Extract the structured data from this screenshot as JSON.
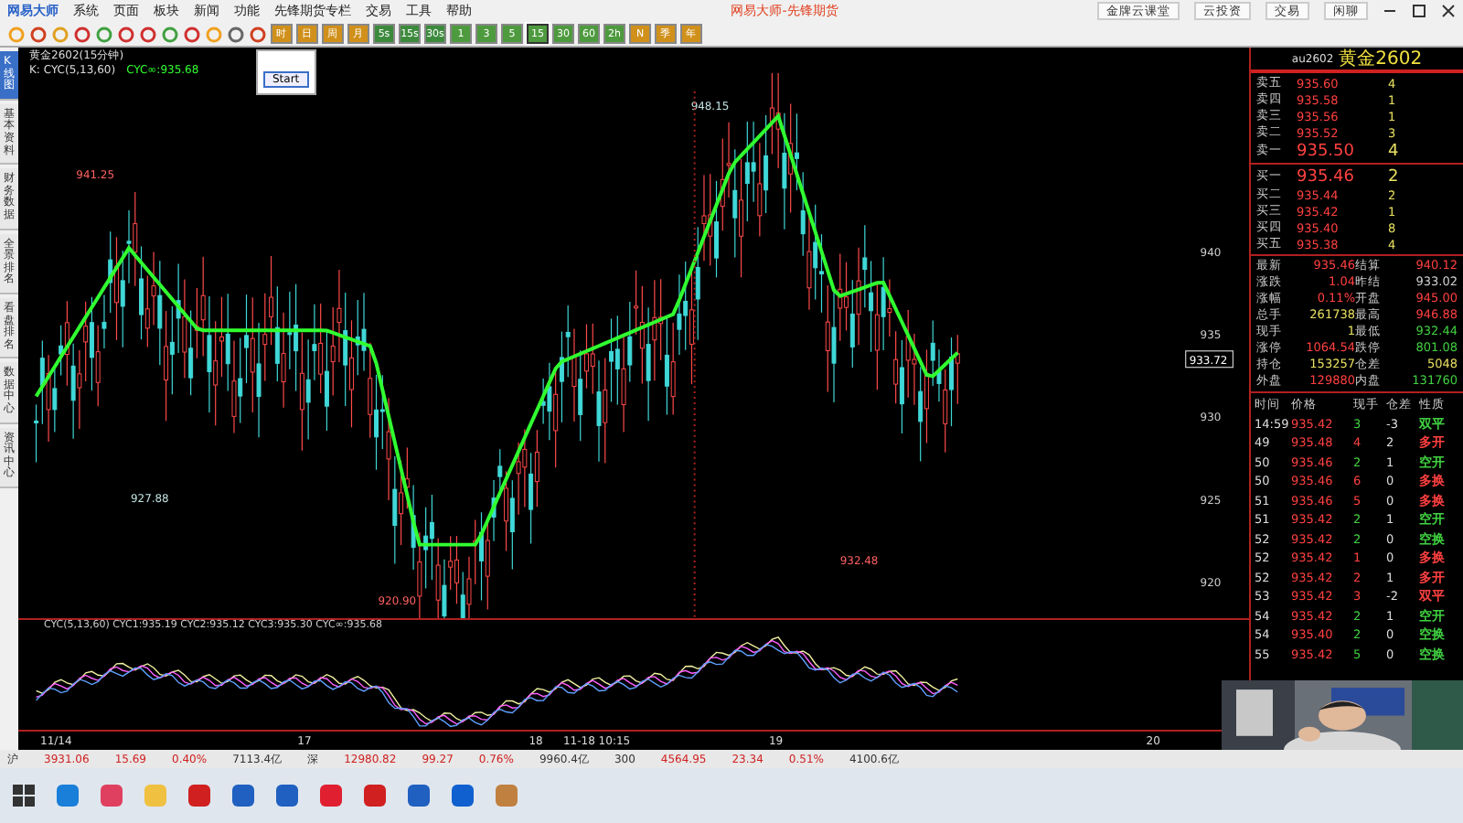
{
  "window": {
    "title": "网易大师-先锋期货",
    "logo": "网易大师"
  },
  "menu": [
    "系统",
    "页面",
    "板块",
    "新闻",
    "功能",
    "先锋期货专栏",
    "交易",
    "工具",
    "帮助"
  ],
  "top_buttons": [
    "金牌云课堂",
    "云投资",
    "交易",
    "闲聊"
  ],
  "periods": [
    {
      "label": "时",
      "selected": false
    },
    {
      "label": "日",
      "selected": false
    },
    {
      "label": "周",
      "selected": false
    },
    {
      "label": "月",
      "selected": false
    },
    {
      "label": "5s",
      "selected": false
    },
    {
      "label": "15s",
      "selected": false
    },
    {
      "label": "30s",
      "selected": false
    },
    {
      "label": "1",
      "selected": false
    },
    {
      "label": "3",
      "selected": false
    },
    {
      "label": "5",
      "selected": false
    },
    {
      "label": "15",
      "selected": true
    },
    {
      "label": "30",
      "selected": false
    },
    {
      "label": "60",
      "selected": false
    },
    {
      "label": "2h",
      "selected": false
    },
    {
      "label": "N",
      "selected": false
    },
    {
      "label": "季",
      "selected": false
    },
    {
      "label": "年",
      "selected": false
    }
  ],
  "side_tabs": [
    {
      "label": "K线图",
      "selected": true
    },
    {
      "label": "基本资料",
      "selected": false
    },
    {
      "label": "财务数据",
      "selected": false
    },
    {
      "label": "全景排名",
      "selected": false
    },
    {
      "label": "看盘排名",
      "selected": false
    },
    {
      "label": "数据中心",
      "selected": false
    },
    {
      "label": "资讯中心",
      "selected": false
    }
  ],
  "popup": {
    "button": "Start"
  },
  "chart": {
    "title": "黄金2602(15分钟)",
    "legend": "K: CYC(5,13,60)",
    "legend_value": "CYC∞:935.68",
    "price_labels": [
      "941.25",
      "927.88",
      "920.90",
      "948.15",
      "932.48"
    ],
    "y_ticks": [
      "940",
      "935",
      "930",
      "925",
      "920"
    ],
    "current_price": "933.72",
    "indicator_legend": "CYC(5,13,60) CYC1:935.19 CYC2:935.12 CYC3:935.30 CYC∞:935.68",
    "x_labels": [
      "11/14",
      "17",
      "18",
      "11-18 10:15",
      "19",
      "20"
    ]
  },
  "quote": {
    "code": "au2602",
    "name": "黄金2602",
    "asks": [
      {
        "label": "卖五",
        "price": "935.60",
        "volume": "4"
      },
      {
        "label": "卖四",
        "price": "935.58",
        "volume": "1"
      },
      {
        "label": "卖三",
        "price": "935.56",
        "volume": "1"
      },
      {
        "label": "卖二",
        "price": "935.52",
        "volume": "3"
      },
      {
        "label": "卖一",
        "price": "935.50",
        "volume": "4"
      }
    ],
    "bids": [
      {
        "label": "买一",
        "price": "935.46",
        "volume": "2"
      },
      {
        "label": "买二",
        "price": "935.44",
        "volume": "2"
      },
      {
        "label": "买三",
        "price": "935.42",
        "volume": "1"
      },
      {
        "label": "买四",
        "price": "935.40",
        "volume": "8"
      },
      {
        "label": "买五",
        "price": "935.38",
        "volume": "4"
      }
    ],
    "stats": [
      {
        "label": "最新",
        "value": "935.46",
        "color": "#ff4040"
      },
      {
        "label": "结算",
        "value": "940.12",
        "color": "#ff4040"
      },
      {
        "label": "涨跌",
        "value": "1.04",
        "color": "#ff4040"
      },
      {
        "label": "昨结",
        "value": "933.02",
        "color": "#d0d0d0"
      },
      {
        "label": "涨幅",
        "value": "0.11%",
        "color": "#ff4040"
      },
      {
        "label": "开盘",
        "value": "945.00",
        "color": "#ff4040"
      },
      {
        "label": "总手",
        "value": "261738",
        "color": "#e8e060"
      },
      {
        "label": "最高",
        "value": "946.88",
        "color": "#ff4040"
      },
      {
        "label": "现手",
        "value": "1",
        "color": "#e8e060"
      },
      {
        "label": "最低",
        "value": "932.44",
        "color": "#40d040"
      },
      {
        "label": "涨停",
        "value": "1064.54",
        "color": "#ff4040"
      },
      {
        "label": "跌停",
        "value": "801.08",
        "color": "#40d040"
      },
      {
        "label": "持仓",
        "value": "153257",
        "color": "#e8e060"
      },
      {
        "label": "仓差",
        "value": "5048",
        "color": "#e8e060"
      },
      {
        "label": "外盘",
        "value": "129880",
        "color": "#ff4040"
      },
      {
        "label": "内盘",
        "value": "131760",
        "color": "#40d040"
      }
    ],
    "tick_columns": [
      "时间",
      "价格",
      "现手",
      "仓差",
      "性质"
    ],
    "ticks": [
      {
        "time": "14:59",
        "price": "935.42",
        "volume": "3",
        "change": "-3",
        "nature": "双平",
        "color": "#40d040"
      },
      {
        "time": "49",
        "price": "935.48",
        "volume": "4",
        "change": "2",
        "nature": "多开",
        "color": "#ff4040"
      },
      {
        "time": "50",
        "price": "935.46",
        "volume": "2",
        "change": "1",
        "nature": "空开",
        "color": "#40d040"
      },
      {
        "time": "50",
        "price": "935.46",
        "volume": "6",
        "change": "0",
        "nature": "多换",
        "color": "#ff4040"
      },
      {
        "time": "51",
        "price": "935.46",
        "volume": "5",
        "change": "0",
        "nature": "多换",
        "color": "#ff4040"
      },
      {
        "time": "51",
        "price": "935.42",
        "volume": "2",
        "change": "1",
        "nature": "空开",
        "color": "#40d040"
      },
      {
        "time": "52",
        "price": "935.42",
        "volume": "2",
        "change": "0",
        "nature": "空换",
        "color": "#40d040"
      },
      {
        "time": "52",
        "price": "935.42",
        "volume": "1",
        "change": "0",
        "nature": "多换",
        "color": "#ff4040"
      },
      {
        "time": "52",
        "price": "935.42",
        "volume": "2",
        "change": "1",
        "nature": "多开",
        "color": "#ff4040"
      },
      {
        "time": "53",
        "price": "935.42",
        "volume": "3",
        "change": "-2",
        "nature": "双平",
        "color": "#ff4040"
      },
      {
        "time": "54",
        "price": "935.42",
        "volume": "2",
        "change": "1",
        "nature": "空开",
        "color": "#40d040"
      },
      {
        "time": "54",
        "price": "935.40",
        "volume": "2",
        "change": "0",
        "nature": "空换",
        "color": "#40d040"
      },
      {
        "time": "55",
        "price": "935.42",
        "volume": "5",
        "change": "0",
        "nature": "空换",
        "color": "#40d040"
      }
    ]
  },
  "webcam": {
    "kind": "picture"
  },
  "indices": [
    {
      "name": "沪",
      "value": "3931.06",
      "change": "15.69",
      "pct": "0.40%",
      "amount": "7113.4亿"
    },
    {
      "name": "深",
      "value": "12980.82",
      "change": "99.27",
      "pct": "0.76%",
      "amount": "9960.4亿"
    },
    {
      "name": "300",
      "value": "4564.95",
      "change": "23.34",
      "pct": "0.51%",
      "amount": "4100.6亿"
    }
  ]
}
